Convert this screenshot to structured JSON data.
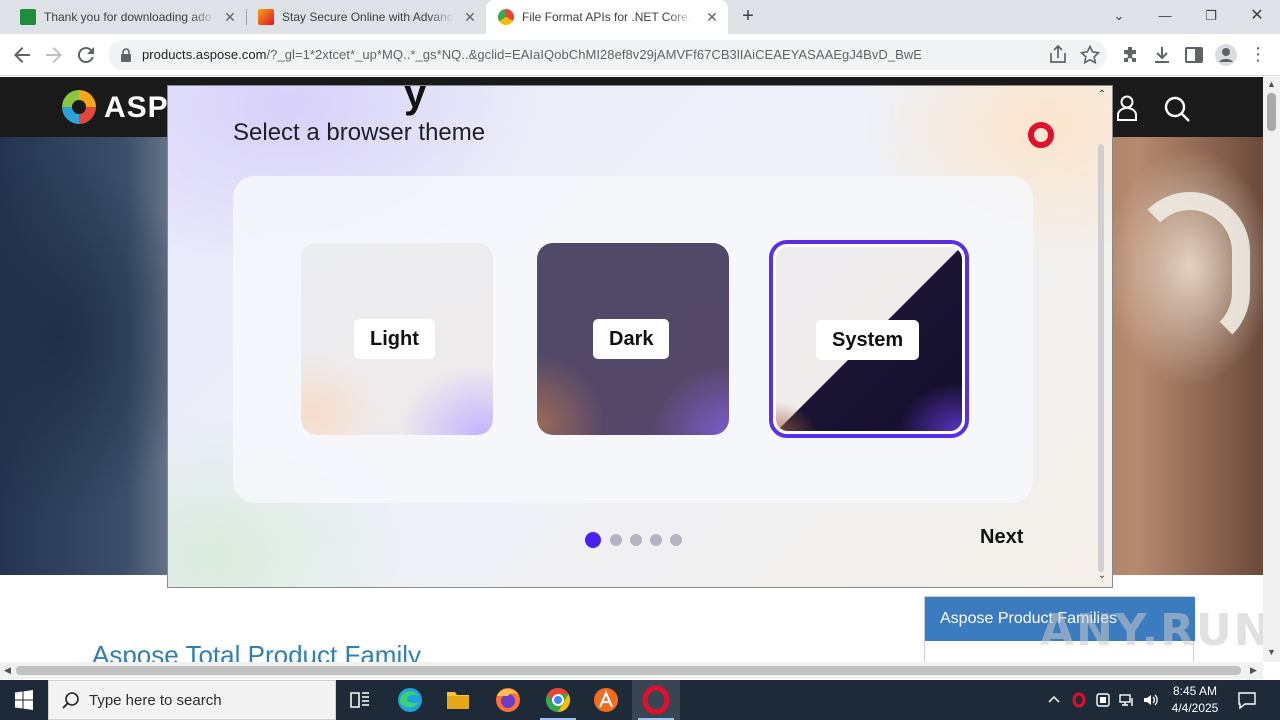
{
  "browser": {
    "tabs": [
      {
        "title": "Thank you for downloading ado",
        "favicon_color": "#1e8e3e"
      },
      {
        "title": "Stay Secure Online with Advanc",
        "favicon_color": "#f3a712"
      },
      {
        "title": "File Format APIs for .NET Core, J",
        "favicon_color": "#4285f4"
      }
    ],
    "url_host": "products.aspose.com",
    "url_rest": "/?_gl=1*2xtcet*_up*MQ..*_gs*NQ..&gclid=EAIaIQobChMI28ef8v29jAMVFf67CB3lIAiCEAEYASAAEgJ4BvD_BwE"
  },
  "page": {
    "brand": "ASPO",
    "family_title": "Aspose Total Product Family",
    "families_header": "Aspose Product Families",
    "watermark": "ANY.RUN"
  },
  "dialog": {
    "title": "Select a browser theme",
    "themes": [
      {
        "label": "Light",
        "selected": false
      },
      {
        "label": "Dark",
        "selected": false
      },
      {
        "label": "System",
        "selected": true
      }
    ],
    "steps_total": 5,
    "step_current": 1,
    "next_label": "Next",
    "accent": "#4a1fef",
    "logo_color": "#e0102c"
  },
  "taskbar": {
    "search_placeholder": "Type here to search",
    "time": "8:45 AM",
    "date": "4/4/2025"
  }
}
